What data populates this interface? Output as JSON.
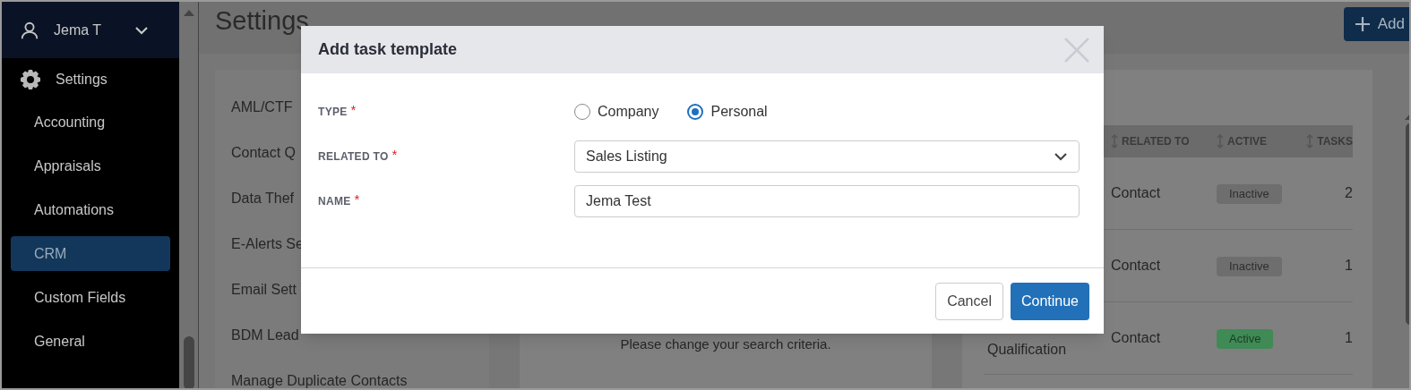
{
  "sidebar": {
    "user": {
      "name": "Jema T"
    },
    "section": {
      "label": "Settings"
    },
    "items": [
      {
        "label": "Accounting",
        "selected": false
      },
      {
        "label": "Appraisals",
        "selected": false
      },
      {
        "label": "Automations",
        "selected": false
      },
      {
        "label": "CRM",
        "selected": true
      },
      {
        "label": "Custom Fields",
        "selected": false
      },
      {
        "label": "General",
        "selected": false
      }
    ]
  },
  "page": {
    "title": "Settings",
    "add_button": "Add"
  },
  "settings_list": [
    "AML/CTF",
    "Contact Q",
    "Data Thef",
    "E-Alerts Se",
    "Email Sett",
    "BDM Lead",
    "Manage Duplicate Contacts"
  ],
  "empty_message": "Please change your search criteria.",
  "table": {
    "columns": [
      "RELATED TO",
      "ACTIVE",
      "TASKS"
    ],
    "rows": [
      {
        "related_to": "Contact",
        "status": "Inactive",
        "active": false,
        "tasks": "2"
      },
      {
        "related_to": "Contact",
        "status": "Inactive",
        "active": false,
        "tasks": "1"
      },
      {
        "name": "Qualification",
        "related_to": "Contact",
        "status": "Active",
        "active": true,
        "tasks": "1"
      }
    ]
  },
  "modal": {
    "title": "Add task template",
    "fields": [
      {
        "kind": "radio",
        "label": "TYPE",
        "required_mark": "*",
        "options": [
          {
            "label": "Company",
            "selected": false
          },
          {
            "label": "Personal",
            "selected": true
          }
        ]
      },
      {
        "kind": "select",
        "label": "RELATED TO",
        "required_mark": "*",
        "value": "Sales Listing"
      },
      {
        "kind": "text",
        "label": "NAME",
        "required_mark": "*",
        "value": "Jema Test"
      }
    ],
    "buttons": [
      {
        "label": "Cancel",
        "kind": "secondary"
      },
      {
        "label": "Continue",
        "kind": "primary"
      }
    ]
  }
}
